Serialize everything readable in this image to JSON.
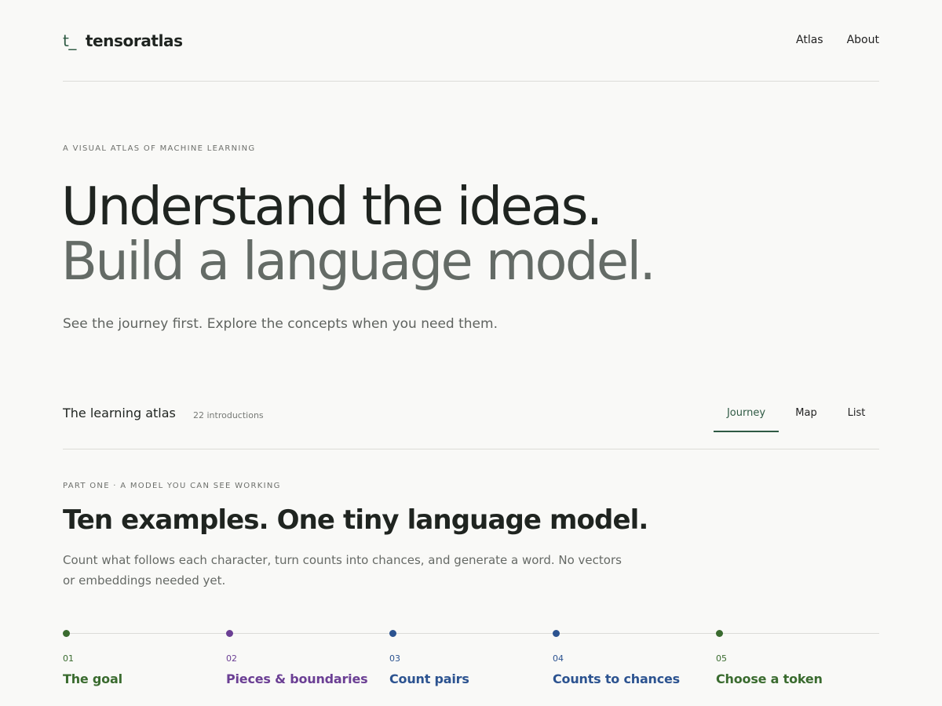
{
  "header": {
    "logo_mark": "t_",
    "logo_text": "tensoratlas",
    "nav": [
      "Atlas",
      "About"
    ]
  },
  "hero": {
    "eyebrow": "A VISUAL ATLAS OF MACHINE LEARNING",
    "line1": "Understand the ideas.",
    "line2": "Build a language model.",
    "subtitle": "See the journey first. Explore the concepts when you need them."
  },
  "atlas": {
    "title": "The learning atlas",
    "count": "22 introductions",
    "tabs": [
      "Journey",
      "Map",
      "List"
    ],
    "active_tab": "Journey"
  },
  "part": {
    "eyebrow": "PART ONE · A MODEL YOU CAN SEE WORKING",
    "title": "Ten examples. One tiny language model.",
    "description": "Count what follows each character, turn counts into chances, and generate a word. No vectors or embeddings needed yet."
  },
  "steps": [
    {
      "num": "01",
      "label": "The goal",
      "color": "#3a6b2f"
    },
    {
      "num": "02",
      "label": "Pieces & boundaries",
      "color": "#6b3f94"
    },
    {
      "num": "03",
      "label": "Count pairs",
      "color": "#2c5390"
    },
    {
      "num": "04",
      "label": "Counts to chances",
      "color": "#2c5390"
    },
    {
      "num": "05",
      "label": "Choose a token",
      "color": "#3a6b2f"
    }
  ],
  "colors": {
    "accent": "#2f5a44",
    "background": "#f9f9f7",
    "muted_heading": "#646b66"
  }
}
